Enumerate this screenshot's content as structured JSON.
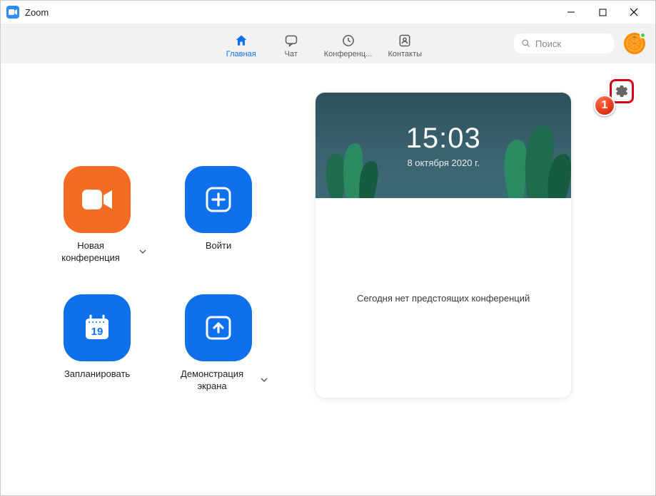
{
  "window": {
    "title": "Zoom"
  },
  "nav": {
    "tabs": [
      {
        "label": "Главная",
        "icon": "home",
        "active": true
      },
      {
        "label": "Чат",
        "icon": "chat",
        "active": false
      },
      {
        "label": "Конференц...",
        "icon": "clock",
        "active": false
      },
      {
        "label": "Контакты",
        "icon": "contacts",
        "active": false
      }
    ],
    "search_placeholder": "Поиск"
  },
  "actions": {
    "new_meeting": {
      "label": "Новая конференция",
      "has_dropdown": true,
      "color": "orange",
      "icon": "video"
    },
    "join": {
      "label": "Войти",
      "has_dropdown": false,
      "color": "blue",
      "icon": "plus"
    },
    "schedule": {
      "label": "Запланировать",
      "has_dropdown": false,
      "color": "blue",
      "icon": "calendar",
      "calendar_day": "19"
    },
    "share": {
      "label": "Демонстрация экрана",
      "has_dropdown": true,
      "color": "blue",
      "icon": "share"
    }
  },
  "card": {
    "time": "15:03",
    "date": "8 октября 2020 г.",
    "empty_message": "Сегодня нет предстоящих конференций"
  },
  "annotation": {
    "badge": "1"
  },
  "colors": {
    "accent_blue": "#0e71eb",
    "accent_orange": "#f26d21",
    "annotation_red": "#d4001a"
  }
}
